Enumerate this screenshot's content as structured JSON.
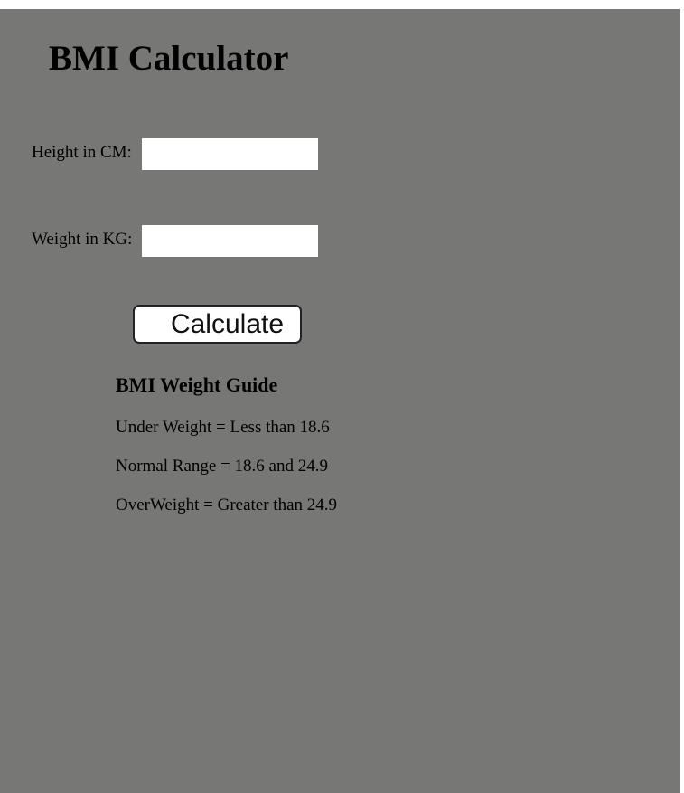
{
  "app": {
    "title": "BMI Calculator"
  },
  "form": {
    "height_label": "Height in CM:",
    "height_value": "",
    "weight_label": "Weight in KG:",
    "weight_value": "",
    "calculate_label": "Calculate"
  },
  "guide": {
    "title": "BMI Weight Guide",
    "lines": [
      "Under Weight = Less than 18.6",
      "Normal Range = 18.6 and 24.9",
      "OverWeight = Greater than 24.9"
    ]
  },
  "colors": {
    "panel_background": "#777775",
    "page_background": "#ffffff",
    "input_background": "#ffffff"
  }
}
